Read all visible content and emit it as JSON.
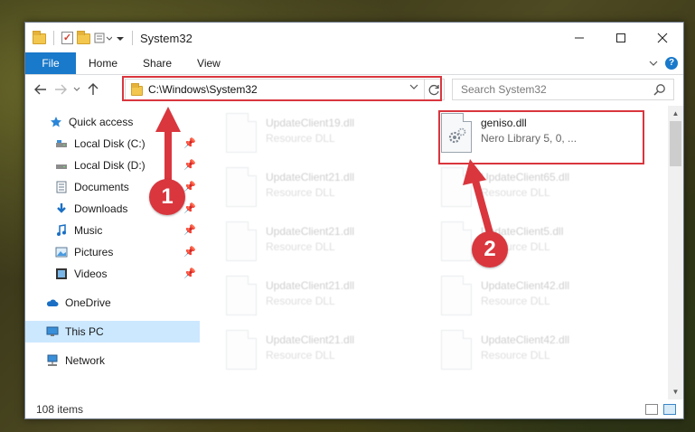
{
  "window": {
    "title": "System32"
  },
  "ribbon": {
    "tabs": [
      "File",
      "Home",
      "Share",
      "View"
    ],
    "help": "?"
  },
  "nav": {
    "address": "C:\\Windows\\System32",
    "search_placeholder": "Search System32"
  },
  "sidebar": {
    "items": [
      {
        "label": "Quick access",
        "icon": "star-icon"
      },
      {
        "label": "Local Disk (C:)",
        "icon": "drive-icon",
        "pinned": true
      },
      {
        "label": "Local Disk (D:)",
        "icon": "drive-icon",
        "pinned": true
      },
      {
        "label": "Documents",
        "icon": "documents-icon",
        "pinned": true
      },
      {
        "label": "Downloads",
        "icon": "download-arrow-icon",
        "pinned": true
      },
      {
        "label": "Music",
        "icon": "music-note-icon",
        "pinned": true
      },
      {
        "label": "Pictures",
        "icon": "pictures-icon",
        "pinned": true
      },
      {
        "label": "Videos",
        "icon": "film-icon",
        "pinned": true
      },
      {
        "label": "OneDrive",
        "icon": "cloud-icon"
      },
      {
        "label": "This PC",
        "icon": "monitor-icon",
        "selected": true
      },
      {
        "label": "Network",
        "icon": "network-icon"
      }
    ]
  },
  "files": {
    "left_column": [
      {
        "name": "UpdateClient19.dll",
        "desc": "Resource DLL"
      },
      {
        "name": "UpdateClient21.dll",
        "desc": "Resource DLL"
      },
      {
        "name": "UpdateClient21.dll",
        "desc": "Resource DLL"
      },
      {
        "name": "UpdateClient21.dll",
        "desc": "Resource DLL"
      },
      {
        "name": "UpdateClient21.dll",
        "desc": "Resource DLL"
      }
    ],
    "right_column": [
      {
        "name": "geniso.dll",
        "desc": "Nero Library 5, 0, ..."
      },
      {
        "name": "UpdateClient65.dll",
        "desc": "Resource DLL"
      },
      {
        "name": "UpdateClient5.dll",
        "desc": "Resource DLL"
      },
      {
        "name": "UpdateClient42.dll",
        "desc": "Resource DLL"
      },
      {
        "name": "UpdateClient42.dll",
        "desc": "Resource DLL"
      }
    ]
  },
  "status": {
    "items_count": "108 items"
  },
  "annotations": {
    "step1": "1",
    "step2": "2",
    "color": "#d9363e"
  },
  "colors": {
    "accent": "#1979ca",
    "selection": "#cce8ff"
  }
}
